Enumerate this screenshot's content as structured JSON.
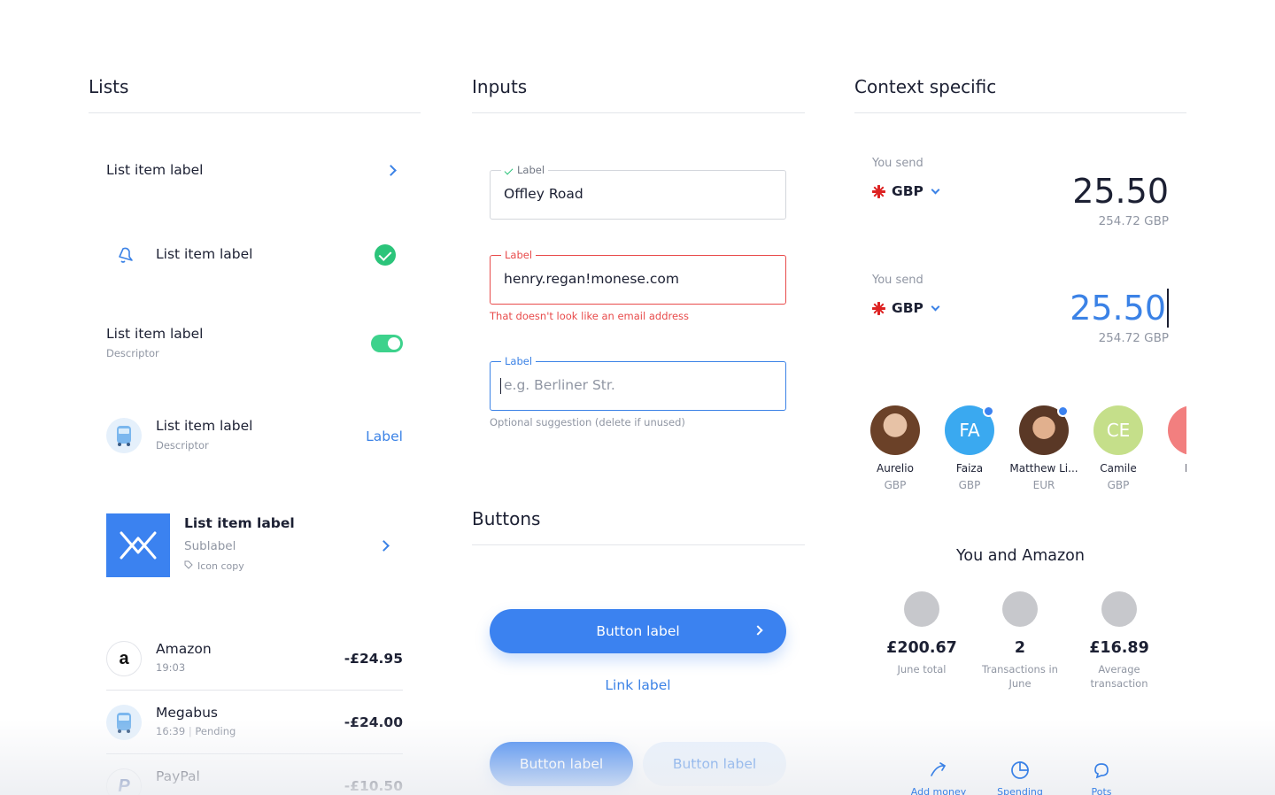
{
  "lists": {
    "title": "Lists",
    "item1": {
      "label": "List item label"
    },
    "item2": {
      "label": "List item label"
    },
    "item3": {
      "label": "List item label",
      "descriptor": "Descriptor"
    },
    "item4": {
      "label": "List item label",
      "descriptor": "Descriptor",
      "action": "Label"
    },
    "item5": {
      "label": "List item label",
      "sublabel": "Sublabel",
      "icon_copy": "Icon copy"
    },
    "transactions": [
      {
        "merchant": "Amazon",
        "time": "19:03",
        "status": "",
        "amount": "-£24.95",
        "logo": "a"
      },
      {
        "merchant": "Megabus",
        "time": "16:39",
        "status": "Pending",
        "amount": "-£24.00"
      },
      {
        "merchant": "PayPal",
        "time": "",
        "status": "",
        "amount": "-£10.50",
        "logo": "P"
      }
    ]
  },
  "inputs": {
    "title": "Inputs",
    "field1": {
      "label": "Label",
      "value": "Offley Road"
    },
    "field2": {
      "label": "Label",
      "value": "henry.regan!monese.com",
      "error": "That doesn't look like an email address"
    },
    "field3": {
      "label": "Label",
      "placeholder": "e.g. Berliner Str.",
      "helper": "Optional suggestion (delete if unused)"
    }
  },
  "buttons": {
    "title": "Buttons",
    "primary": "Button label",
    "link": "Link label",
    "small_primary": "Button label",
    "small_secondary": "Button label"
  },
  "context": {
    "title": "Context specific",
    "send1": {
      "label": "You send",
      "currency": "GBP",
      "amount": "25.50",
      "converted": "254.72 GBP"
    },
    "send2": {
      "label": "You send",
      "currency": "GBP",
      "amount": "25.50",
      "converted": "254.72 GBP"
    },
    "contacts": [
      {
        "name": "Aurelio",
        "currency": "GBP",
        "initials": "",
        "color": "#b07a5c"
      },
      {
        "name": "Faiza",
        "currency": "GBP",
        "initials": "FA",
        "color": "#3aa9f0"
      },
      {
        "name": "Matthew Li...",
        "currency": "EUR",
        "initials": "",
        "color": "#8a5a3a"
      },
      {
        "name": "Camile",
        "currency": "GBP",
        "initials": "CE",
        "color": "#c5df8a"
      },
      {
        "name": "Mo",
        "currency": "C",
        "initials": "M",
        "color": "#f27f7f"
      }
    ],
    "summary": {
      "title": "You and Amazon",
      "stats": [
        {
          "value": "£200.67",
          "caption": "June total"
        },
        {
          "value": "2",
          "caption": "Transactions in June"
        },
        {
          "value": "£16.89",
          "caption": "Average transaction"
        }
      ]
    },
    "nav": [
      {
        "label": "Add money",
        "icon": "add-money-icon"
      },
      {
        "label": "Spending",
        "icon": "spending-icon"
      },
      {
        "label": "Pots",
        "icon": "pots-icon"
      }
    ]
  },
  "colors": {
    "accent": "#3b82f0",
    "success": "#2bc47a",
    "error": "#e84b4b",
    "text": "#1c2033",
    "muted": "#9096a3"
  }
}
